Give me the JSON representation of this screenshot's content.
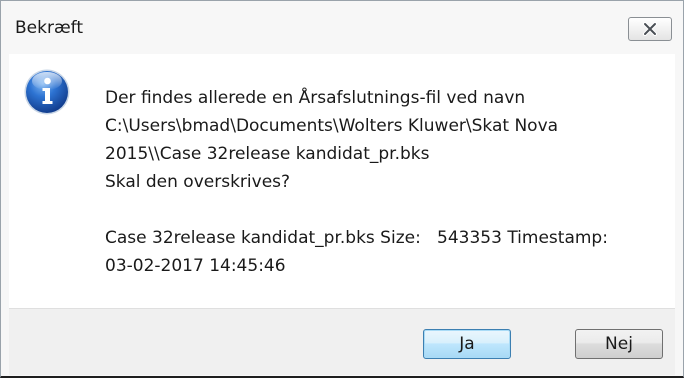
{
  "window": {
    "title": "Bekræft"
  },
  "message": {
    "line1": "Der findes allerede en Årsafslutnings-fil ved navn",
    "line2": "C:\\Users\\bmad\\Documents\\Wolters Kluwer\\Skat Nova",
    "line3": "2015\\\\Case 32release kandidat_pr.bks",
    "line4": "Skal den overskrives?",
    "line5": "Case 32release kandidat_pr.bks Size:   543353 Timestamp:",
    "line6": "03-02-2017 14:45:46"
  },
  "buttons": {
    "yes_label": "Ja",
    "no_label": "Nej"
  },
  "icons": {
    "info": "info-icon",
    "close": "close-icon"
  },
  "colors": {
    "info_blue": "#1f5fb8",
    "default_button_border": "#3c7fb1"
  }
}
